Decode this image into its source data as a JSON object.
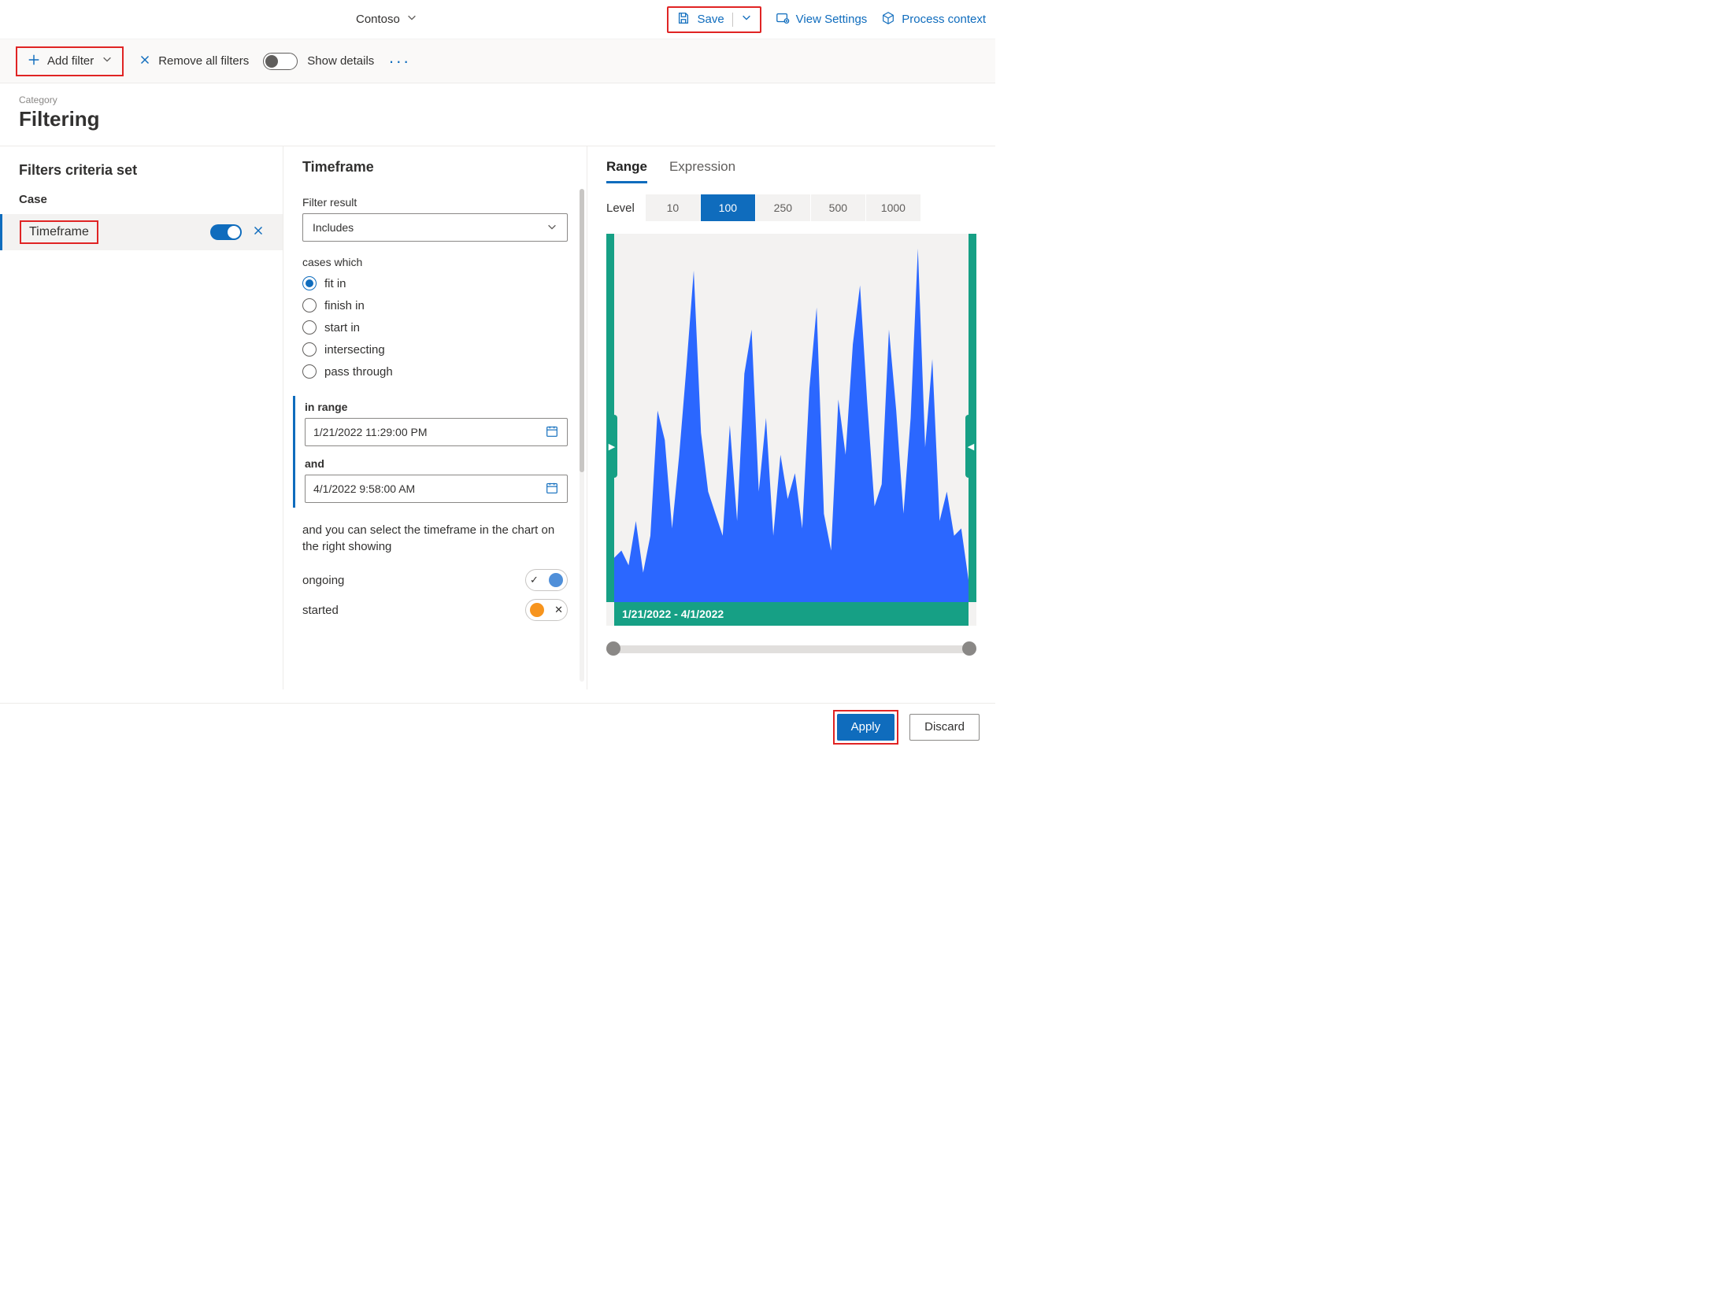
{
  "topbar": {
    "org": "Contoso",
    "save": "Save",
    "view_settings": "View Settings",
    "process_context": "Process context"
  },
  "toolbar": {
    "add_filter": "Add filter",
    "remove_all": "Remove all filters",
    "show_details": "Show details"
  },
  "heading": {
    "category": "Category",
    "title": "Filtering"
  },
  "left": {
    "title": "Filters criteria set",
    "group": "Case",
    "filter_name": "Timeframe"
  },
  "mid": {
    "title": "Timeframe",
    "filter_result_label": "Filter result",
    "filter_result_value": "Includes",
    "cases_which": "cases which",
    "radios": {
      "fit_in": "fit in",
      "finish_in": "finish in",
      "start_in": "start in",
      "intersecting": "intersecting",
      "pass_through": "pass through"
    },
    "in_range": "in range",
    "from": "1/21/2022 11:29:00 PM",
    "and": "and",
    "to": "4/1/2022 9:58:00 AM",
    "help": "and you can select the timeframe in the chart on the right showing",
    "legend_ongoing": "ongoing",
    "legend_started": "started"
  },
  "right": {
    "tab_range": "Range",
    "tab_expression": "Expression",
    "level_label": "Level",
    "levels": [
      "10",
      "100",
      "250",
      "500",
      "1000"
    ],
    "active_level": "100",
    "chart_range": "1/21/2022 - 4/1/2022"
  },
  "footer": {
    "apply": "Apply",
    "discard": "Discard"
  },
  "chart_data": {
    "type": "area",
    "title": "",
    "xlabel": "",
    "ylabel": "",
    "x_range": [
      "1/21/2022",
      "4/1/2022"
    ],
    "ylim": [
      0,
      100
    ],
    "series": [
      {
        "name": "ongoing",
        "color": "#2b67ff",
        "values": [
          12,
          14,
          10,
          22,
          8,
          18,
          52,
          44,
          20,
          40,
          64,
          90,
          46,
          30,
          24,
          18,
          48,
          22,
          62,
          74,
          30,
          50,
          18,
          40,
          28,
          35,
          20,
          58,
          80,
          24,
          14,
          55,
          40,
          70,
          86,
          54,
          26,
          32,
          74,
          52,
          24,
          50,
          96,
          42,
          66,
          22,
          30,
          18,
          20,
          6
        ]
      }
    ]
  }
}
